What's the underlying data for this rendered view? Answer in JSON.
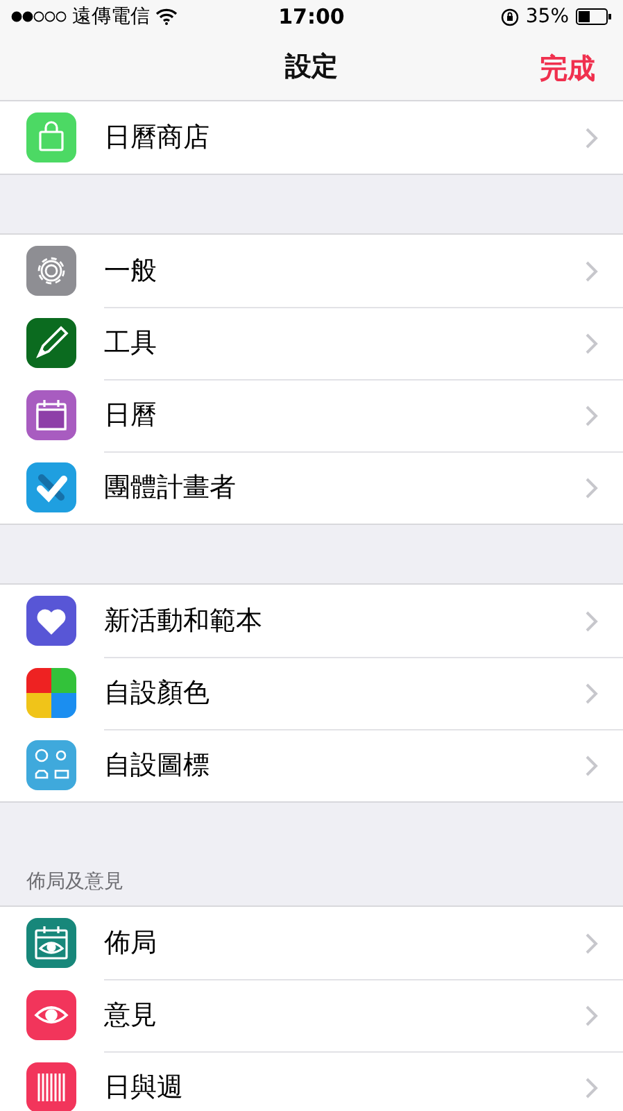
{
  "status_bar": {
    "carrier": "遠傳電信",
    "time": "17:00",
    "battery": "35%"
  },
  "nav": {
    "title": "設定",
    "done": "完成"
  },
  "sections": [
    {
      "items": [
        {
          "label": "日曆商店",
          "kind": "bag",
          "color": "#4cd964"
        }
      ]
    },
    {
      "items": [
        {
          "label": "一般",
          "kind": "gear",
          "color": "#8e8e93"
        },
        {
          "label": "工具",
          "kind": "pencil",
          "color": "#0b6b1f"
        },
        {
          "label": "日曆",
          "kind": "calendar",
          "color": "#a85cc0"
        },
        {
          "label": "團體計畫者",
          "kind": "check",
          "color": "#1f9fe0"
        }
      ]
    },
    {
      "items": [
        {
          "label": "新活動和範本",
          "kind": "heart",
          "color": "#5856d6"
        },
        {
          "label": "自設顏色",
          "kind": "quad"
        },
        {
          "label": "自設圖標",
          "kind": "symbols",
          "color": "#3fa9dc"
        }
      ]
    },
    {
      "header": "佈局及意見",
      "items": [
        {
          "label": "佈局",
          "kind": "eyecal",
          "color": "#17877a"
        },
        {
          "label": "意見",
          "kind": "eye",
          "color": "#f2355b"
        },
        {
          "label": "日與週",
          "kind": "stripes",
          "color": "#f2355b"
        }
      ]
    }
  ]
}
